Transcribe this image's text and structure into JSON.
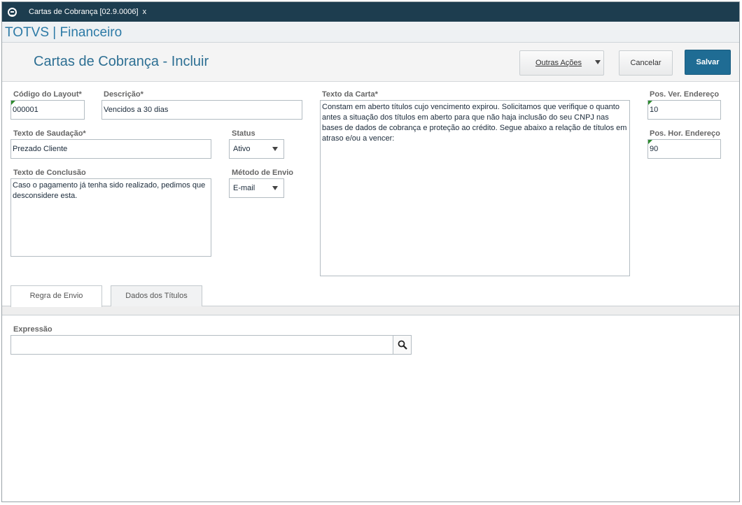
{
  "window": {
    "tab_title": "Cartas de Cobrança [02.9.0006]",
    "tab_close": "x"
  },
  "brand": "TOTVS | Financeiro",
  "header": {
    "title": "Cartas de Cobrança - Incluir",
    "more_actions": "Outras Ações",
    "cancel": "Cancelar",
    "save": "Salvar"
  },
  "form": {
    "codigo_layout": {
      "label": "Código do Layout*",
      "value": "000001"
    },
    "descricao": {
      "label": "Descrição*",
      "value": "Vencidos a 30 dias"
    },
    "texto_carta": {
      "label": "Texto da Carta*",
      "value": "Constam em aberto títulos cujo vencimento expirou. Solicitamos que verifique o quanto antes a situação dos títulos em aberto para que não haja inclusão do seu CNPJ nas bases de dados de cobrança e proteção ao crédito. Segue abaixo a relação de títulos em atraso e/ou a vencer:"
    },
    "pos_ver": {
      "label": "Pos. Ver. Endereço",
      "value": "10"
    },
    "texto_saudacao": {
      "label": "Texto de Saudação*",
      "value": "Prezado Cliente"
    },
    "status": {
      "label": "Status",
      "value": "Ativo"
    },
    "pos_hor": {
      "label": "Pos. Hor. Endereço",
      "value": "90"
    },
    "texto_conclusao": {
      "label": "Texto de Conclusão",
      "value": "Caso o pagamento já tenha sido realizado, pedimos que desconsidere esta."
    },
    "metodo_envio": {
      "label": "Método de Envio",
      "value": "E-mail"
    }
  },
  "tabs": [
    {
      "label": "Regra de Envio",
      "active": true
    },
    {
      "label": "Dados dos Títulos",
      "active": false
    }
  ],
  "expressao": {
    "label": "Expressão",
    "value": ""
  },
  "icons": {
    "app": "totvs-logo-icon",
    "search": "search-icon",
    "dropdown": "chevron-down-icon"
  },
  "colors": {
    "title_bar": "#1d3d4f",
    "accent": "#2c7aa6",
    "save_button": "#1f6c94",
    "required_marker": "#2e8b2e"
  }
}
